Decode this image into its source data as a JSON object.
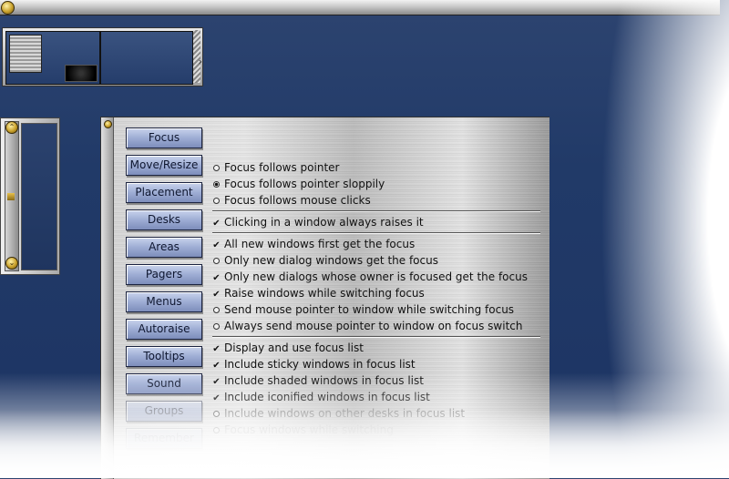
{
  "pager": {},
  "tabs": [
    {
      "label": "Focus"
    },
    {
      "label": "Move/Resize"
    },
    {
      "label": "Placement"
    },
    {
      "label": "Desks"
    },
    {
      "label": "Areas"
    },
    {
      "label": "Pagers"
    },
    {
      "label": "Menus"
    },
    {
      "label": "Autoraise"
    },
    {
      "label": "Tooltips"
    },
    {
      "label": "Sound"
    },
    {
      "label": "Groups"
    },
    {
      "label": "Remember"
    }
  ],
  "focus_options": {
    "focus_mode": [
      {
        "label": "Focus follows pointer",
        "selected": false
      },
      {
        "label": "Focus follows pointer sloppily",
        "selected": true
      },
      {
        "label": "Focus follows mouse clicks",
        "selected": false
      }
    ],
    "click_raise": {
      "label": "Clicking in a window always raises it",
      "checked": true
    },
    "new_windows": [
      {
        "label": "All new windows first get the focus",
        "kind": "check",
        "checked": true
      },
      {
        "label": "Only new dialog windows get the focus",
        "kind": "radio",
        "checked": false
      },
      {
        "label": "Only new dialogs whose owner is focused get the focus",
        "kind": "check",
        "checked": true
      },
      {
        "label": "Raise windows while switching focus",
        "kind": "check",
        "checked": true
      },
      {
        "label": "Send mouse pointer to window while switching focus",
        "kind": "radio",
        "checked": false
      },
      {
        "label": "Always send mouse pointer to window on focus switch",
        "kind": "radio",
        "checked": false
      }
    ],
    "focus_list": [
      {
        "label": "Display and use focus list",
        "kind": "check",
        "checked": true
      },
      {
        "label": "Include sticky windows in focus list",
        "kind": "check",
        "checked": true
      },
      {
        "label": "Include shaded windows in focus list",
        "kind": "check",
        "checked": true
      },
      {
        "label": "Include iconified windows in focus list",
        "kind": "check",
        "checked": true
      },
      {
        "label": "Include windows on other desks in focus list",
        "kind": "radio",
        "checked": false
      },
      {
        "label": "Focus windows while switching",
        "kind": "radio",
        "checked": false
      }
    ]
  },
  "colors": {
    "desktop": "#213a68",
    "tab_button": "#9eadd4",
    "accent_gold": "#c9a12b"
  }
}
